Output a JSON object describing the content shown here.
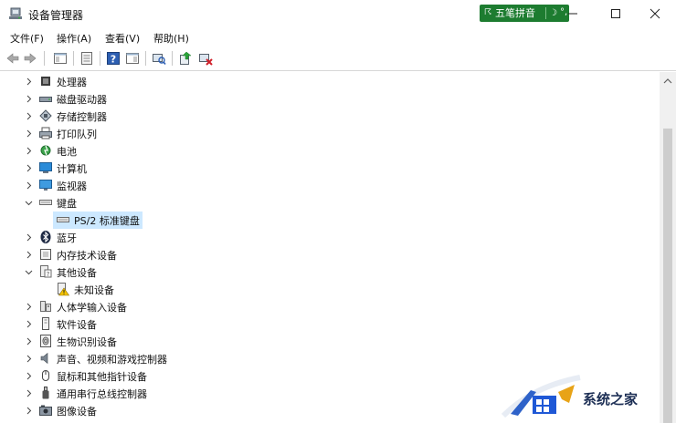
{
  "window": {
    "title": "设备管理器"
  },
  "ime": {
    "label": "五笔拼音",
    "moon": "☽",
    "punct": "°,"
  },
  "menu": [
    "文件(F)",
    "操作(A)",
    "查看(V)",
    "帮助(H)"
  ],
  "tree": [
    {
      "label": "处理器",
      "state": "collapsed",
      "icon": "processor-icon"
    },
    {
      "label": "磁盘驱动器",
      "state": "collapsed",
      "icon": "disk-drive-icon"
    },
    {
      "label": "存储控制器",
      "state": "collapsed",
      "icon": "storage-controller-icon"
    },
    {
      "label": "打印队列",
      "state": "collapsed",
      "icon": "printer-icon"
    },
    {
      "label": "电池",
      "state": "collapsed",
      "icon": "battery-icon"
    },
    {
      "label": "计算机",
      "state": "collapsed",
      "icon": "computer-icon"
    },
    {
      "label": "监视器",
      "state": "collapsed",
      "icon": "monitor-icon"
    },
    {
      "label": "键盘",
      "state": "expanded",
      "icon": "keyboard-icon"
    },
    {
      "label": "PS/2 标准键盘",
      "state": "leaf",
      "icon": "keyboard-icon",
      "selected": true
    },
    {
      "label": "蓝牙",
      "state": "collapsed",
      "icon": "bluetooth-icon"
    },
    {
      "label": "内存技术设备",
      "state": "collapsed",
      "icon": "memory-device-icon"
    },
    {
      "label": "其他设备",
      "state": "expanded",
      "icon": "other-devices-icon"
    },
    {
      "label": "未知设备",
      "state": "leaf",
      "icon": "unknown-device-warning-icon"
    },
    {
      "label": "人体学输入设备",
      "state": "collapsed",
      "icon": "hid-icon"
    },
    {
      "label": "软件设备",
      "state": "collapsed",
      "icon": "software-device-icon"
    },
    {
      "label": "生物识别设备",
      "state": "collapsed",
      "icon": "fingerprint-icon"
    },
    {
      "label": "声音、视频和游戏控制器",
      "state": "collapsed",
      "icon": "speaker-icon"
    },
    {
      "label": "鼠标和其他指针设备",
      "state": "collapsed",
      "icon": "mouse-icon"
    },
    {
      "label": "通用串行总线控制器",
      "state": "collapsed",
      "icon": "usb-icon"
    },
    {
      "label": "图像设备",
      "state": "collapsed",
      "icon": "camera-icon"
    }
  ],
  "watermark": {
    "text": "系统之家"
  }
}
